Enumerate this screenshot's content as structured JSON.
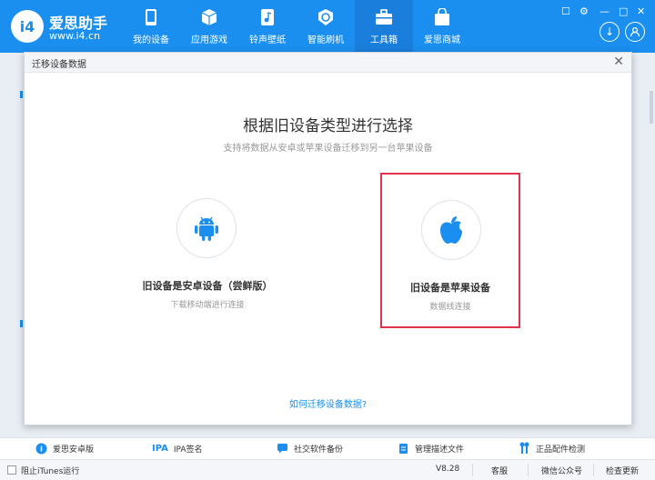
{
  "app": {
    "logo_text": "i4",
    "brand_name": "爱思助手",
    "brand_url": "www.i4.cn"
  },
  "nav": {
    "items": [
      {
        "label": "我的设备",
        "icon": "phone-icon"
      },
      {
        "label": "应用游戏",
        "icon": "cube-icon"
      },
      {
        "label": "铃声壁纸",
        "icon": "music-file-icon"
      },
      {
        "label": "智能刷机",
        "icon": "refresh-shield-icon"
      },
      {
        "label": "工具箱",
        "icon": "toolbox-icon"
      },
      {
        "label": "爱思商城",
        "icon": "shopping-bag-icon"
      }
    ],
    "active_index": 4
  },
  "window_controls": {
    "download_icon": "download-icon",
    "user_icon": "user-icon"
  },
  "dialog": {
    "title": "迁移设备数据",
    "heading": "根据旧设备类型进行选择",
    "subheading": "支持将数据从安卓或苹果设备迁移到另一台苹果设备",
    "options": [
      {
        "title": "旧设备是安卓设备（尝鲜版）",
        "desc": "下载移动端进行连接",
        "icon": "android-icon"
      },
      {
        "title": "旧设备是苹果设备",
        "desc": "数据线连接",
        "icon": "apple-icon",
        "selected": true
      }
    ],
    "help_link": "如何迁移设备数据?"
  },
  "tools": [
    {
      "label": "爱思安卓版",
      "icon": "android-app-icon"
    },
    {
      "label": "IPA签名",
      "icon_text": "IPA",
      "icon": "ipa-icon"
    },
    {
      "label": "社交软件备份",
      "icon": "chat-backup-icon"
    },
    {
      "label": "管理描述文件",
      "icon": "profile-icon"
    },
    {
      "label": "正品配件检测",
      "icon": "earphone-icon"
    }
  ],
  "status_bar": {
    "itunes_label": "阻止iTunes运行",
    "version": "V8.28",
    "feedback": "客服",
    "wechat": "微信公众号",
    "update": "检查更新"
  },
  "colors": {
    "brand_blue": "#1a8ff0",
    "highlight_red": "#e5324b"
  }
}
